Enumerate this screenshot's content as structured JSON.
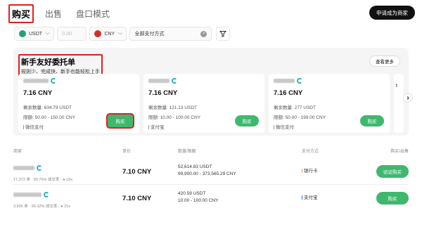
{
  "tabs": [
    {
      "label": "购买"
    },
    {
      "label": "出售"
    },
    {
      "label": "盘口模式"
    }
  ],
  "apply_button": "申请成为商家",
  "filters": {
    "crypto": "USDT",
    "amount_placeholder": "0.00",
    "fiat": "CNY",
    "payment": "全部支付方式"
  },
  "new_user": {
    "title": "新手友好委托单",
    "subtitle": "规则少、完成快、新手也能轻松上手",
    "more_label": "查看更多",
    "cards": [
      {
        "price": "7.16 CNY",
        "remaining": "剩余数量: 634.79 USDT",
        "limit": "限额: 50.00 - 150.00 CNY",
        "payment": "微信支付",
        "buy": "购买"
      },
      {
        "price": "7.16 CNY",
        "remaining": "剩余数量: 121.13 USDT",
        "limit": "限额: 10.00 - 100.00 CNY",
        "payment": "支付宝",
        "buy": "购买"
      },
      {
        "price": "7.16 CNY",
        "remaining": "剩余数量: 277 USDT",
        "limit": "限额: 50.00 - 199.00 CNY",
        "payment": "微信支付",
        "buy": "购买"
      }
    ],
    "partial_card_text": "t"
  },
  "table": {
    "headers": [
      "商家",
      "单价",
      "数量/限额",
      "支付方式",
      "购买/出售"
    ],
    "rows": [
      {
        "stats": "17,373 单 · 99.76% 成交率 · ● 16s",
        "price": "7.10 CNY",
        "qty": "52,614.83 USDT",
        "limit": "99,900.00 - 373,565.29 CNY",
        "payment": "银行卡",
        "action": "验证购买",
        "payment_color": "#e8a33d"
      },
      {
        "stats": "3,836 单 · 99.32% 成交率 · ● 21s",
        "price": "7.10 CNY",
        "qty": "420.59 USDT",
        "limit": "10.00 - 100.00 CNY",
        "payment": "支付宝",
        "action": "购买",
        "payment_color": "#1677ff"
      }
    ]
  },
  "colors": {
    "accent_green": "#3fb86e",
    "highlight_red": "#e02020",
    "brand_dark": "#111111"
  }
}
